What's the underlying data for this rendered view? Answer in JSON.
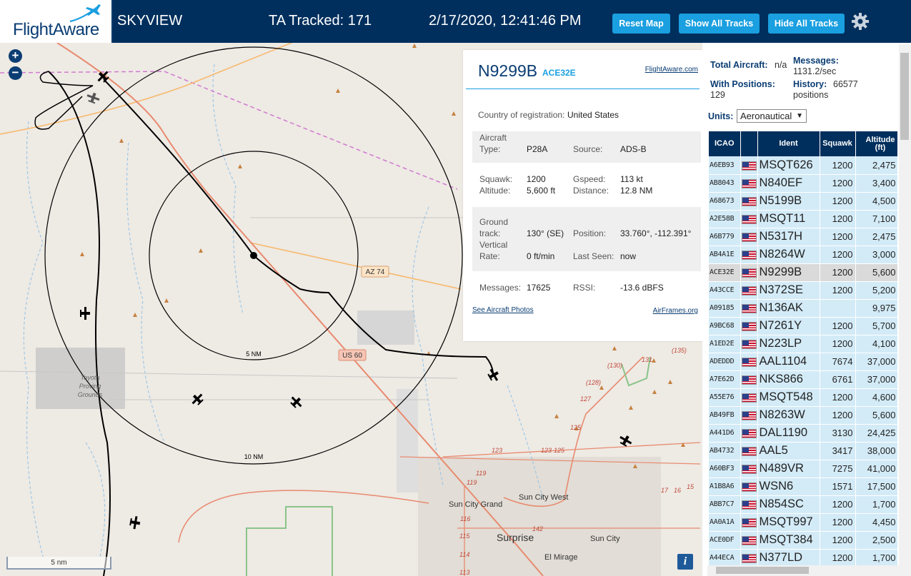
{
  "header": {
    "logo_text": "FlightAware",
    "app_name": "SKYVIEW",
    "ta_tracked_label": "TA Tracked: 171",
    "datetime": "2/17/2020, 12:41:46 PM",
    "buttons": {
      "reset_map": "Reset Map",
      "show_all_tracks": "Show All Tracks",
      "hide_all_tracks": "Hide All Tracks"
    },
    "settings_icon": "gear-icon"
  },
  "map": {
    "zoom_in": "+",
    "zoom_out": "−",
    "scale_label": "5 nm",
    "info_button": "i",
    "range_rings": [
      "5 NM",
      "10 NM"
    ],
    "road_labels": [
      "AZ 74",
      "US 60"
    ],
    "place_labels": [
      "Sun City West",
      "Sun City Grand",
      "Surprise",
      "Sun City",
      "El Mirage"
    ],
    "proving_grounds": [
      "Toyota",
      "Proving",
      "Grounds"
    ],
    "route_numbers": [
      "(135)",
      "131",
      "(130)",
      "(128)",
      "127",
      "125",
      "125",
      "123",
      "123",
      "119",
      "119",
      "116",
      "115",
      "114",
      "113",
      "142",
      "17",
      "16",
      "15"
    ],
    "colors": {
      "background": "#eeeae4",
      "track": "#000000",
      "range_ring": "#000000",
      "highway": "#f7b96d",
      "major_road": "#e88a6f",
      "boundary": "#d07ad0"
    }
  },
  "detail": {
    "callsign": "N9299B",
    "hex": "ACE32E",
    "flightaware_link": "FlightAware.com",
    "country_label": "Country of registration:",
    "country_value": "United States",
    "aircraft_type_label_1": "Aircraft",
    "aircraft_type_label_2": "Type:",
    "aircraft_type_value": "P28A",
    "source_label": "Source:",
    "source_value": "ADS-B",
    "squawk_label": "Squawk:",
    "squawk_value": "1200",
    "altitude_label": "Altitude:",
    "altitude_value": "5,600 ft",
    "gspeed_label": "Gspeed:",
    "gspeed_value": "113 kt",
    "distance_label": "Distance:",
    "distance_value": "12.8 NM",
    "ground_track_label_1": "Ground",
    "ground_track_label_2": "track:",
    "ground_track_value": "130° (SE)",
    "position_label": "Position:",
    "position_value": "33.760°, -112.391°",
    "vertical_rate_label_1": "Vertical",
    "vertical_rate_label_2": "Rate:",
    "vertical_rate_value": "0 ft/min",
    "last_seen_label": "Last Seen:",
    "last_seen_value": "now",
    "messages_label": "Messages:",
    "messages_value": "17625",
    "rssi_label": "RSSI:",
    "rssi_value": "-13.6 dBFS",
    "photos_link": "See Aircraft Photos",
    "airframes_link": "AirFrames.org"
  },
  "stats": {
    "total_aircraft_label": "Total Aircraft:",
    "total_aircraft_value": "n/a",
    "messages_label": "Messages:",
    "messages_value": "1131.2/sec",
    "with_positions_label": "With Positions:",
    "with_positions_value": "129",
    "history_label": "History:",
    "history_value_1": "66577",
    "history_value_2": "positions",
    "units_label": "Units:",
    "units_value": "Aeronautical"
  },
  "table": {
    "headers": [
      "ICAO",
      "",
      "Ident",
      "Squawk",
      "Altitude (ft)"
    ],
    "rows": [
      {
        "icao": "A6EB93",
        "ident": "MSQT626",
        "squawk": "1200",
        "alt": "2,475",
        "trend": ""
      },
      {
        "icao": "AB8043",
        "ident": "N840EF",
        "squawk": "1200",
        "alt": "3,400",
        "trend": "▲"
      },
      {
        "icao": "A68673",
        "ident": "N5199B",
        "squawk": "1200",
        "alt": "4,500",
        "trend": ""
      },
      {
        "icao": "A2E58B",
        "ident": "MSQT11",
        "squawk": "1200",
        "alt": "7,100",
        "trend": "▲"
      },
      {
        "icao": "A6B779",
        "ident": "N5317H",
        "squawk": "1200",
        "alt": "2,475",
        "trend": "▼"
      },
      {
        "icao": "AB4A1E",
        "ident": "N8264W",
        "squawk": "1200",
        "alt": "3,000",
        "trend": "▼"
      },
      {
        "icao": "ACE32E",
        "ident": "N9299B",
        "squawk": "1200",
        "alt": "5,600",
        "trend": "",
        "selected": true
      },
      {
        "icao": "A43CCE",
        "ident": "N372SE",
        "squawk": "1200",
        "alt": "5,200",
        "trend": "▼"
      },
      {
        "icao": "A09185",
        "ident": "N136AK",
        "squawk": "",
        "alt": "9,975",
        "trend": ""
      },
      {
        "icao": "A9BC68",
        "ident": "N7261Y",
        "squawk": "1200",
        "alt": "5,700",
        "trend": ""
      },
      {
        "icao": "A1ED2E",
        "ident": "N223LP",
        "squawk": "1200",
        "alt": "4,100",
        "trend": "▼"
      },
      {
        "icao": "ADEDDD",
        "ident": "AAL1104",
        "squawk": "7674",
        "alt": "37,000",
        "trend": ""
      },
      {
        "icao": "A7E62D",
        "ident": "NKS866",
        "squawk": "6761",
        "alt": "37,000",
        "trend": ""
      },
      {
        "icao": "A55E76",
        "ident": "MSQT548",
        "squawk": "1200",
        "alt": "4,600",
        "trend": ""
      },
      {
        "icao": "AB49FB",
        "ident": "N8263W",
        "squawk": "1200",
        "alt": "5,600",
        "trend": "▼"
      },
      {
        "icao": "A441D6",
        "ident": "DAL1190",
        "squawk": "3130",
        "alt": "24,425",
        "trend": "▲"
      },
      {
        "icao": "AB4732",
        "ident": "AAL5",
        "squawk": "3417",
        "alt": "38,000",
        "trend": ""
      },
      {
        "icao": "A60BF3",
        "ident": "N489VR",
        "squawk": "7275",
        "alt": "41,000",
        "trend": ""
      },
      {
        "icao": "A1B8A6",
        "ident": "WSN6",
        "squawk": "1571",
        "alt": "17,500",
        "trend": "▲"
      },
      {
        "icao": "ABB7C7",
        "ident": "N854SC",
        "squawk": "1200",
        "alt": "1,700",
        "trend": "▲"
      },
      {
        "icao": "AA0A1A",
        "ident": "MSQT997",
        "squawk": "1200",
        "alt": "4,450",
        "trend": "▼"
      },
      {
        "icao": "ACE0DF",
        "ident": "MSQT384",
        "squawk": "1200",
        "alt": "2,500",
        "trend": "▼"
      },
      {
        "icao": "A44ECA",
        "ident": "N377LD",
        "squawk": "1200",
        "alt": "1,700",
        "trend": ""
      }
    ]
  }
}
